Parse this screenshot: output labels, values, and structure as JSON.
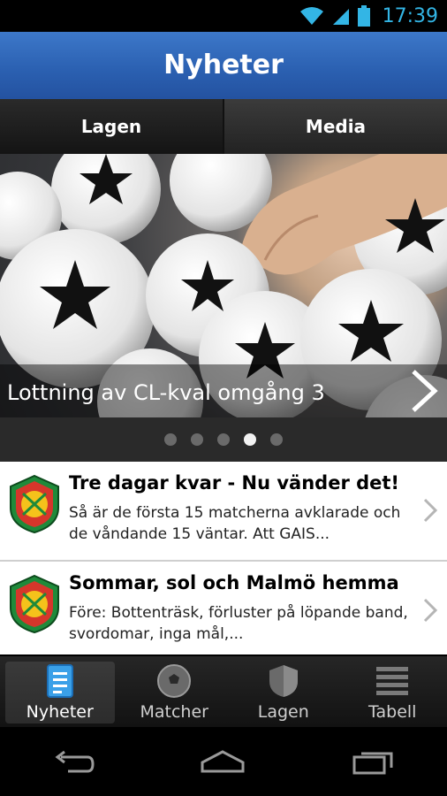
{
  "status": {
    "time": "17:39"
  },
  "header": {
    "title": "Nyheter"
  },
  "tabs": [
    {
      "label": "Lagen"
    },
    {
      "label": "Media"
    }
  ],
  "hero": {
    "caption": "Lottning av CL-kval omgång 3",
    "dots": 5,
    "active_dot": 3
  },
  "news": [
    {
      "title": "Tre dagar kvar - Nu vänder det!",
      "excerpt": "Så är de första 15 matcherna avklarade och de våndande 15 väntar. Att GAIS..."
    },
    {
      "title": "Sommar, sol och Malmö hemma",
      "excerpt": "Före: Bottenträsk, förluster på löpande band, svordomar, inga mål,..."
    }
  ],
  "bottom_nav": [
    {
      "label": "Nyheter",
      "icon": "document-icon",
      "active": true
    },
    {
      "label": "Matcher",
      "icon": "football-icon",
      "active": false
    },
    {
      "label": "Lagen",
      "icon": "shield-icon",
      "active": false
    },
    {
      "label": "Tabell",
      "icon": "list-icon",
      "active": false
    }
  ],
  "colors": {
    "accent": "#33b5e5",
    "header": "#2a5fb0",
    "club_green": "#1f8a3a",
    "club_red": "#d6362b",
    "club_yellow": "#f5c21b"
  }
}
